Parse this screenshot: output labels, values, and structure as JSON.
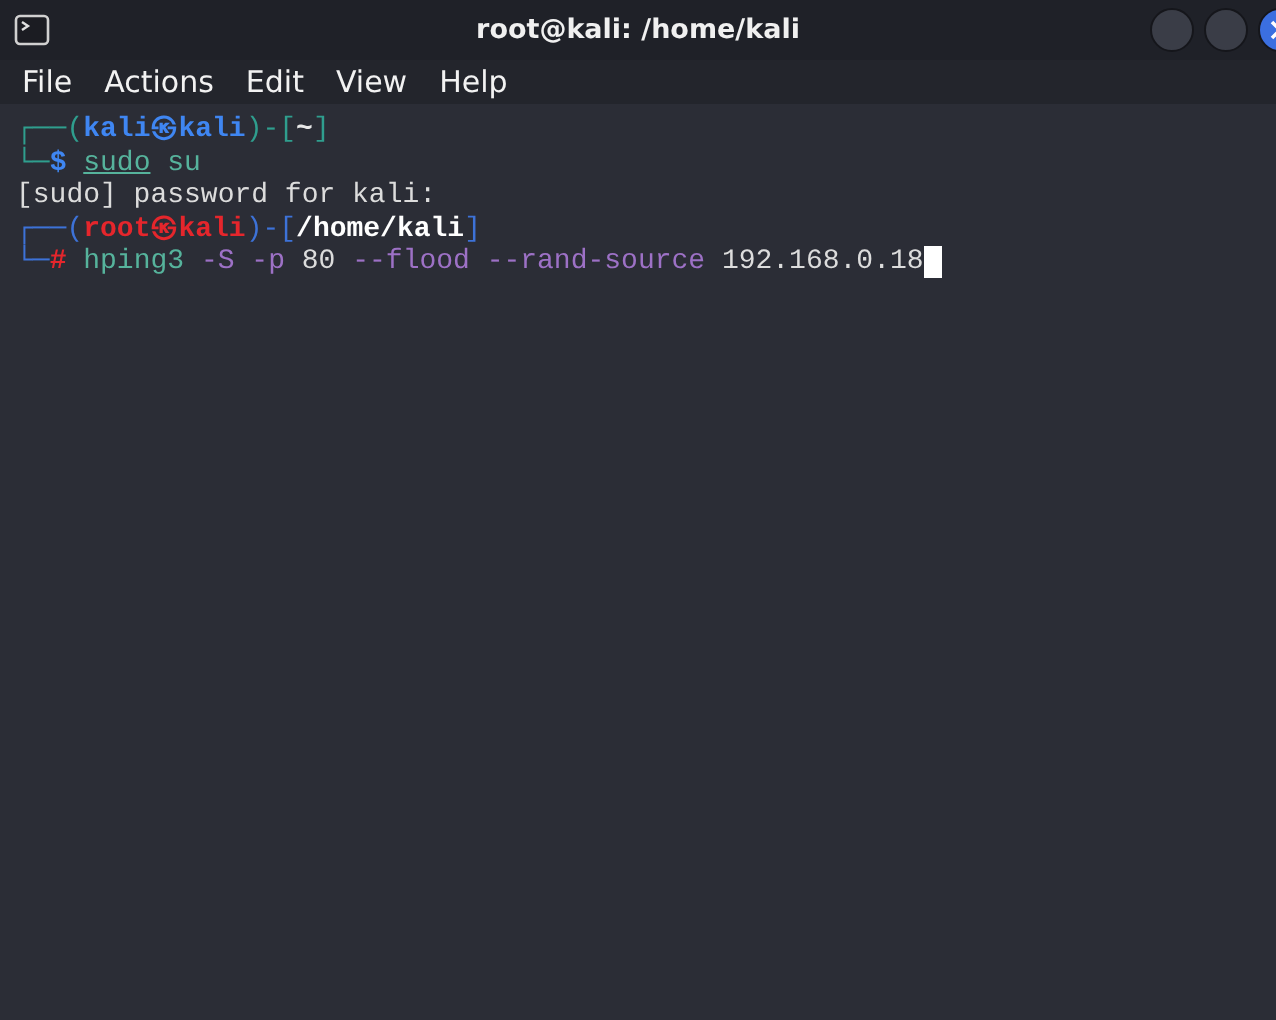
{
  "window": {
    "title": "root@kali: /home/kali"
  },
  "menu": [
    "File",
    "Actions",
    "Edit",
    "View",
    "Help"
  ],
  "terminal": [
    {
      "kind": "prompt",
      "root": false,
      "open": "┌──(",
      "user": "kali",
      "at": "㉿",
      "host": "kali",
      "mid": ")-[",
      "path": "~",
      "close": "]",
      "corner": "└─",
      "sigil": "$",
      "cursor": false,
      "tokens": [
        {
          "text": "sudo",
          "kind": "command",
          "underline": true
        },
        {
          "text": "su",
          "kind": "command",
          "underline": false
        }
      ]
    },
    {
      "kind": "output",
      "text": "[sudo] password for kali:"
    },
    {
      "kind": "prompt",
      "root": true,
      "open": "┌──(",
      "user": "root",
      "at": "㉿",
      "host": "kali",
      "mid": ")-[",
      "path": "/home/kali",
      "close": "]",
      "corner": "└─",
      "sigil": "#",
      "cursor": true,
      "tokens": [
        {
          "text": "hping3",
          "kind": "command",
          "underline": false
        },
        {
          "text": "-S",
          "kind": "option",
          "underline": false
        },
        {
          "text": "-p",
          "kind": "option",
          "underline": false
        },
        {
          "text": "80",
          "kind": "value",
          "underline": false
        },
        {
          "text": "--flood",
          "kind": "option",
          "underline": false
        },
        {
          "text": "--rand-source",
          "kind": "option",
          "underline": false
        },
        {
          "text": "192.168.0.18",
          "kind": "value",
          "underline": false
        }
      ]
    }
  ]
}
